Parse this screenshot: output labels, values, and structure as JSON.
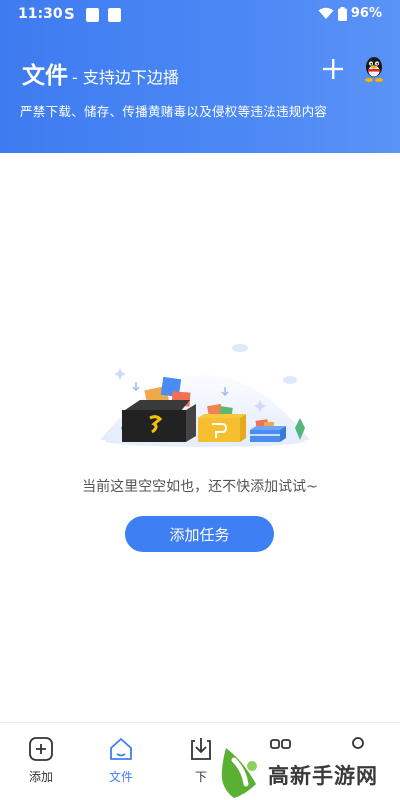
{
  "status_bar": {
    "time": "11:30",
    "s_glyph": "S",
    "battery": "96%"
  },
  "header": {
    "title": "文件",
    "subtitle": "- 支持边下边播",
    "notice": "严禁下载、储存、传播黄赌毒以及侵权等违法违规内容",
    "plus_icon": "plus-icon",
    "qq_icon": "qq-penguin-icon"
  },
  "empty_state": {
    "message": "当前这里空空如也，还不快添加试试~",
    "button_label": "添加任务"
  },
  "bottom_nav": {
    "items": [
      {
        "label": "添加",
        "icon": "add-square-icon",
        "active": false
      },
      {
        "label": "文件",
        "icon": "home-icon",
        "active": true
      },
      {
        "label": "下",
        "icon": "download-icon",
        "active": false
      },
      {
        "label": "",
        "icon": "apps-icon",
        "active": false
      },
      {
        "label": "",
        "icon": "profile-icon",
        "active": false
      }
    ]
  },
  "watermark": {
    "text": "高新手游网"
  },
  "colors": {
    "accent": "#3e7ff3",
    "header_bg": "#4a86f4",
    "watermark_green": "#5ab032"
  }
}
